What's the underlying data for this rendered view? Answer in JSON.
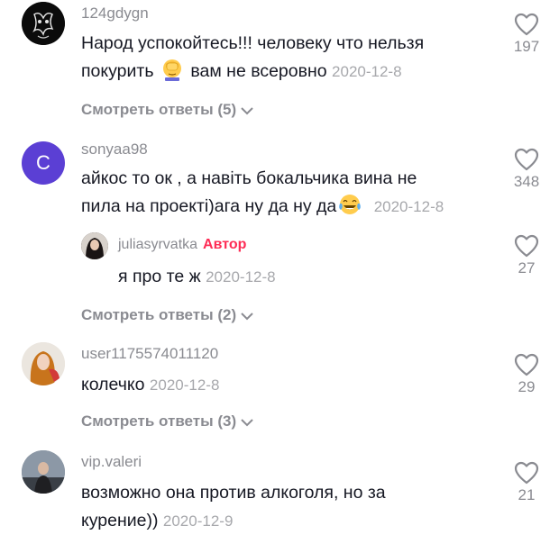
{
  "comments": [
    {
      "username": "124gdygn",
      "text_line1": "Народ успокойтесь!!! человеку что нельзя",
      "text_line2_before": "покурить",
      "text_line2_after": "вам не всеровно",
      "emoji": "facepalm-emoji",
      "timestamp": "2020-12-8",
      "likes": "197",
      "replies_label": "Смотреть ответы (5)"
    },
    {
      "username": "sonyaa98",
      "avatar_letter": "C",
      "avatar_color": "#5b3fd4",
      "text_line1": "айкос то ок , а навіть бокальчика вина не",
      "text_line2": "пила на проекті)ага ну да ну да",
      "emoji": "tears-of-joy-emoji",
      "timestamp": "2020-12-8",
      "likes": "348",
      "reply": {
        "username": "juliasyrvatka",
        "badge": "Автор",
        "text": "я про те ж",
        "timestamp": "2020-12-8",
        "likes": "27"
      },
      "replies_label": "Смотреть ответы (2)"
    },
    {
      "username": "user1175574011120",
      "text": "колечко",
      "timestamp": "2020-12-8",
      "likes": "29",
      "replies_label": "Смотреть ответы (3)"
    },
    {
      "username": "vip.valeri",
      "text_line1": "возможно она против алкоголя, но за",
      "text_line2": "курение))",
      "timestamp": "2020-12-9",
      "likes": "21"
    }
  ],
  "colors": {
    "accent_author": "#fe2c55",
    "muted_text": "#8a8b91",
    "primary_text": "#161823"
  }
}
